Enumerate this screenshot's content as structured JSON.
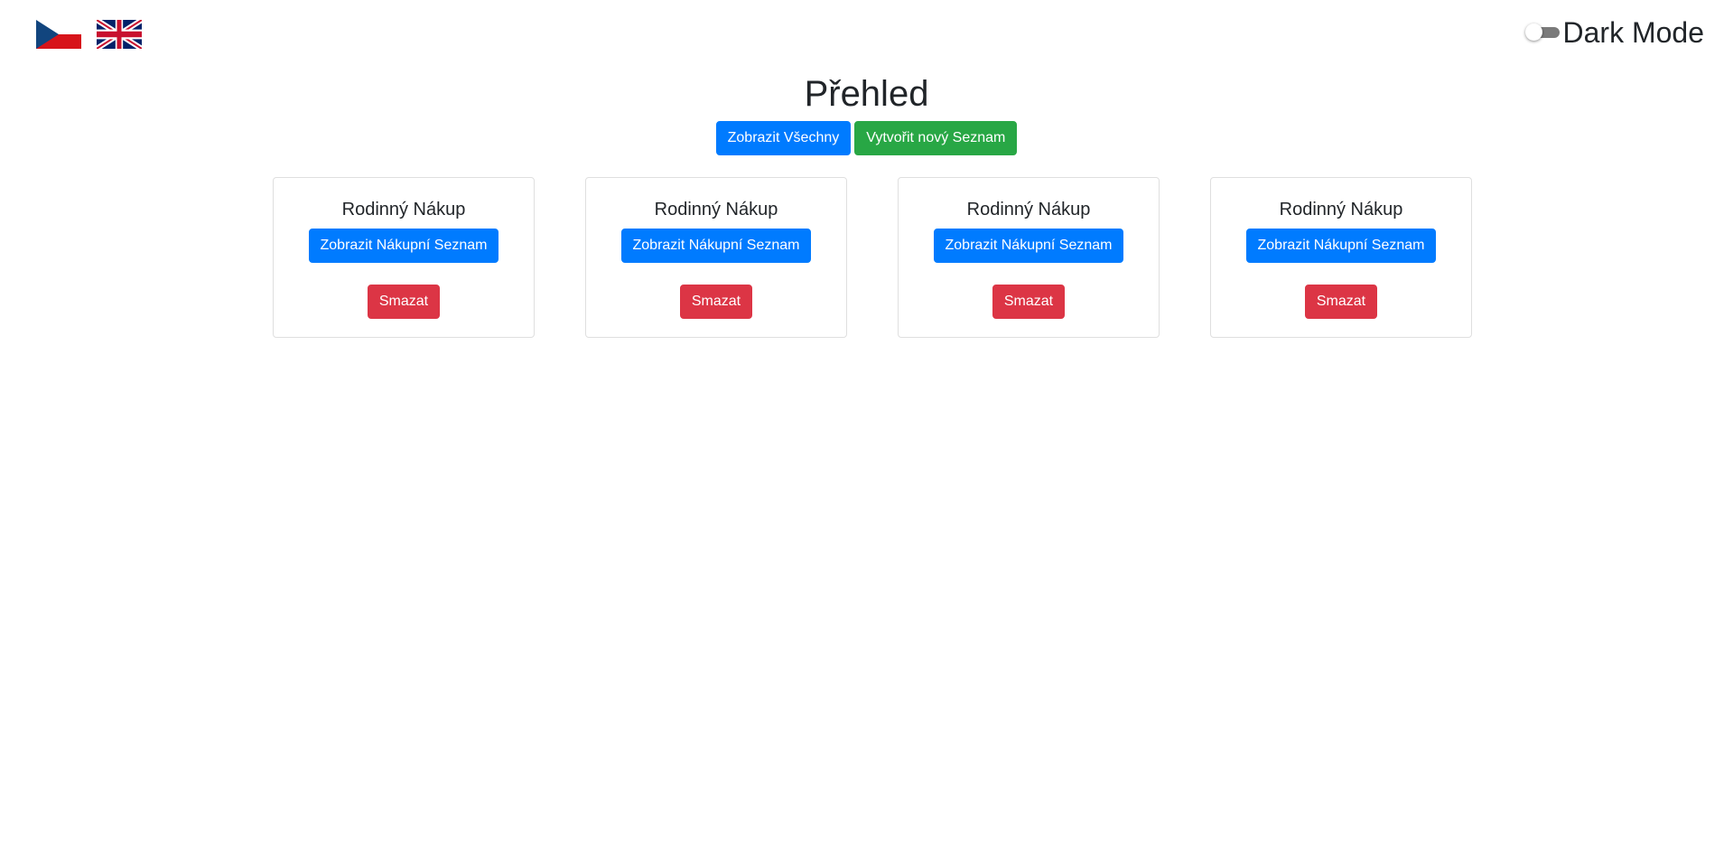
{
  "header": {
    "languages": [
      {
        "code": "cs",
        "icon": "czech-flag-icon"
      },
      {
        "code": "en",
        "icon": "uk-flag-icon"
      }
    ],
    "dark_mode": {
      "label": "Dark Mode",
      "enabled": false
    }
  },
  "page": {
    "title": "Přehled"
  },
  "actions": {
    "show_all_label": "Zobrazit Všechny",
    "create_new_label": "Vytvořit nový Seznam"
  },
  "lists": [
    {
      "title": "Rodinný Nákup",
      "view_label": "Zobrazit Nákupní Seznam",
      "delete_label": "Smazat"
    },
    {
      "title": "Rodinný Nákup",
      "view_label": "Zobrazit Nákupní Seznam",
      "delete_label": "Smazat"
    },
    {
      "title": "Rodinný Nákup",
      "view_label": "Zobrazit Nákupní Seznam",
      "delete_label": "Smazat"
    },
    {
      "title": "Rodinný Nákup",
      "view_label": "Zobrazit Nákupní Seznam",
      "delete_label": "Smazat"
    }
  ],
  "colors": {
    "primary": "#007bff",
    "success": "#28a745",
    "danger": "#dc3545",
    "toggle_track": "#7a7a7a"
  }
}
